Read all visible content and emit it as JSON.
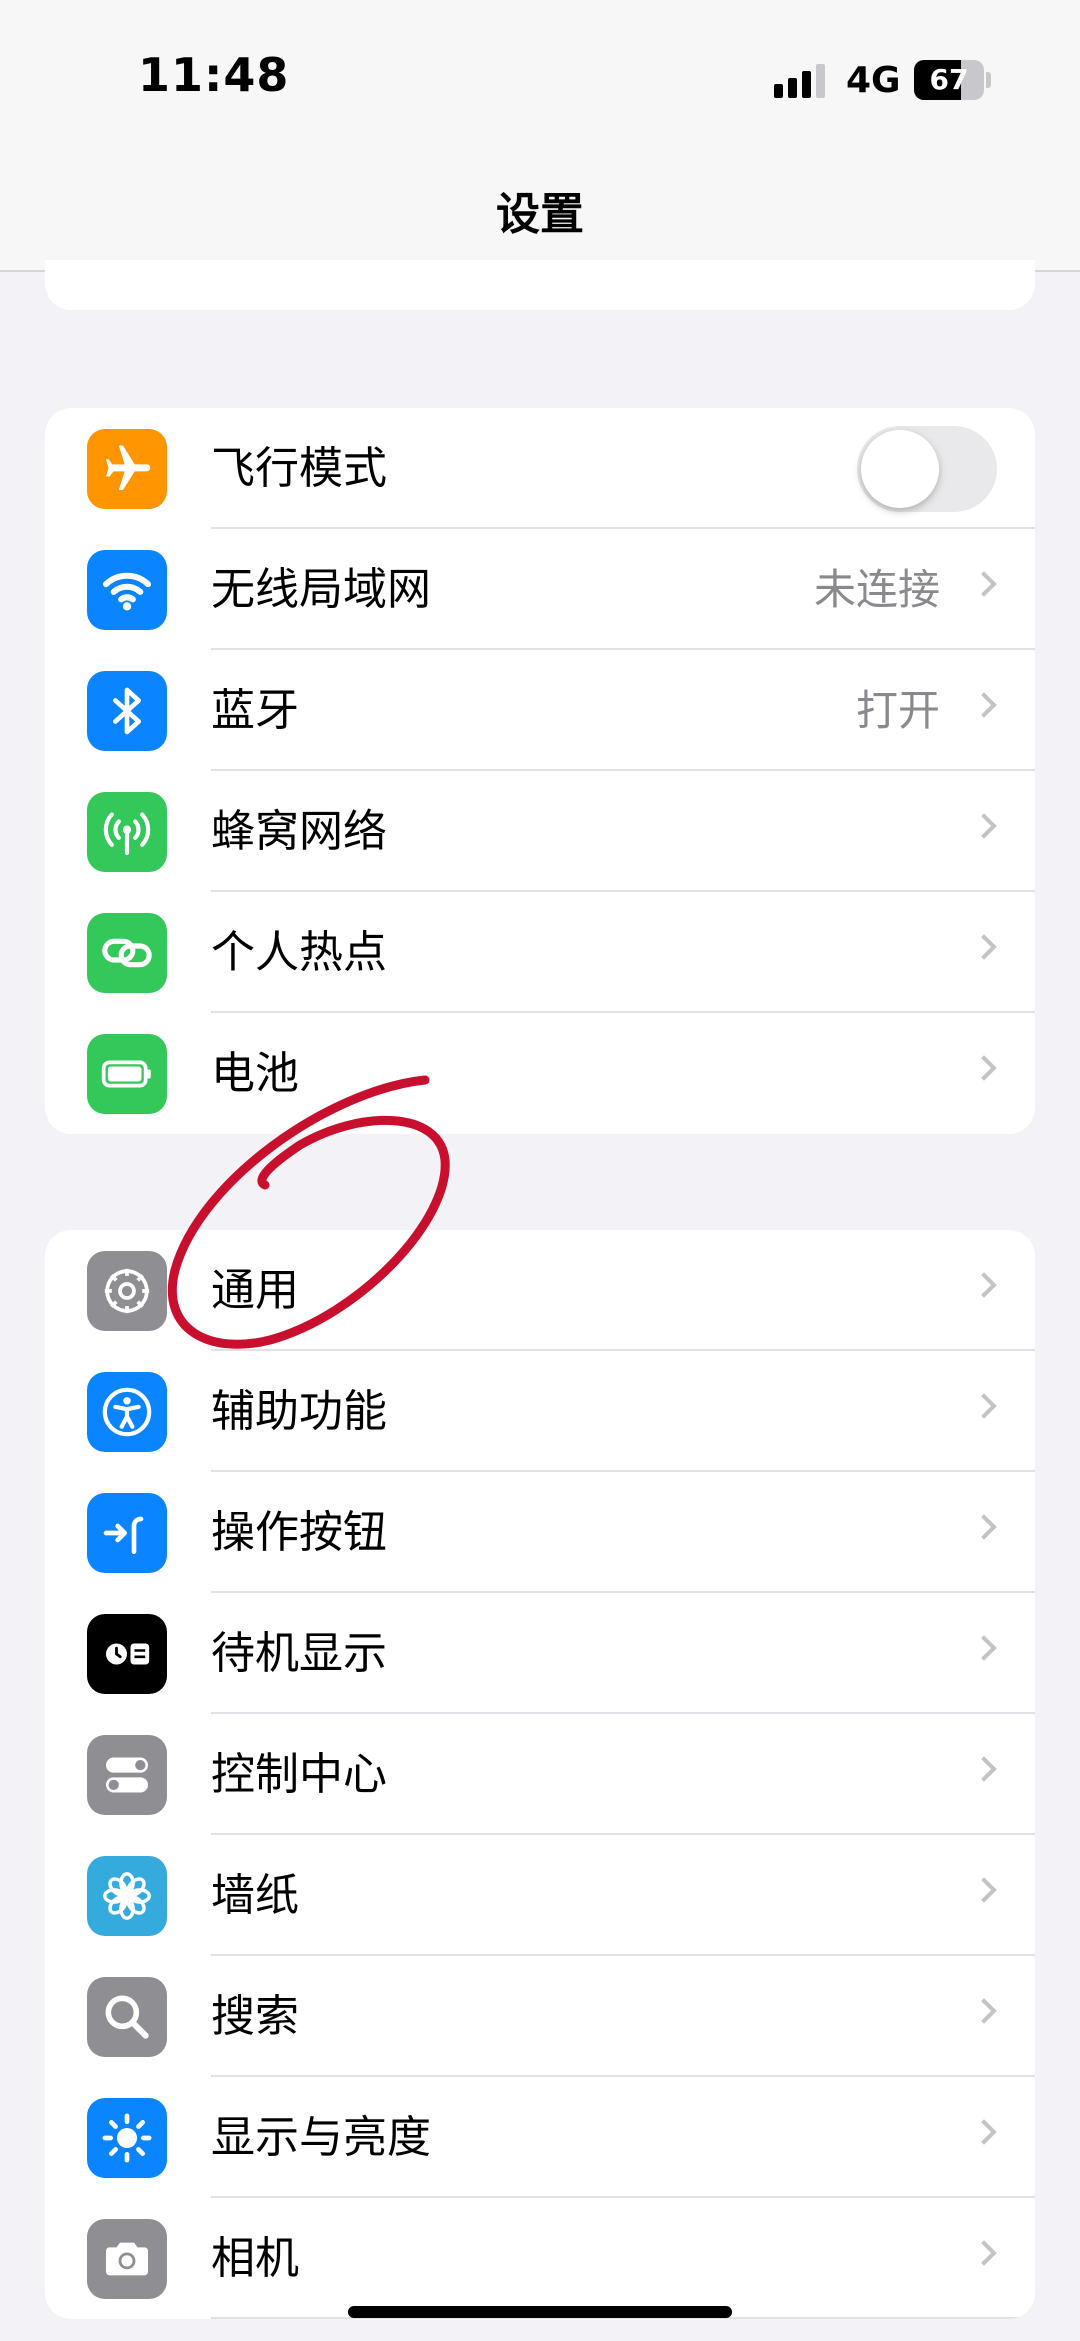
{
  "status_bar": {
    "time": "11:48",
    "network": "4G",
    "battery_percent": "67",
    "battery_level": 0.67
  },
  "nav": {
    "title": "设置"
  },
  "groups": [
    {
      "items": [
        {
          "label": "飞行模式",
          "icon": "airplane-icon",
          "icon_color": "#ff9500",
          "toggle": false
        },
        {
          "label": "无线局域网",
          "value": "未连接",
          "icon": "wifi-icon",
          "icon_color": "#0a84ff"
        },
        {
          "label": "蓝牙",
          "value": "打开",
          "icon": "bluetooth-icon",
          "icon_color": "#0a84ff"
        },
        {
          "label": "蜂窝网络",
          "icon": "cellular-antenna-icon",
          "icon_color": "#34c759"
        },
        {
          "label": "个人热点",
          "icon": "hotspot-link-icon",
          "icon_color": "#34c759"
        },
        {
          "label": "电池",
          "icon": "battery-icon",
          "icon_color": "#34c759"
        }
      ]
    },
    {
      "items": [
        {
          "label": "通用",
          "icon": "gear-icon",
          "icon_color": "#8e8e93"
        },
        {
          "label": "辅助功能",
          "icon": "accessibility-icon",
          "icon_color": "#0a84ff"
        },
        {
          "label": "操作按钮",
          "icon": "action-button-icon",
          "icon_color": "#0a84ff"
        },
        {
          "label": "待机显示",
          "icon": "standby-icon",
          "icon_color": "#000000"
        },
        {
          "label": "控制中心",
          "icon": "control-center-icon",
          "icon_color": "#8e8e93"
        },
        {
          "label": "墙纸",
          "icon": "wallpaper-flower-icon",
          "icon_color": "#35aadc"
        },
        {
          "label": "搜索",
          "icon": "search-icon",
          "icon_color": "#8e8e93"
        },
        {
          "label": "显示与亮度",
          "icon": "brightness-sun-icon",
          "icon_color": "#0a84ff"
        },
        {
          "label": "相机",
          "icon": "camera-icon",
          "icon_color": "#8e8e93"
        }
      ]
    }
  ]
}
